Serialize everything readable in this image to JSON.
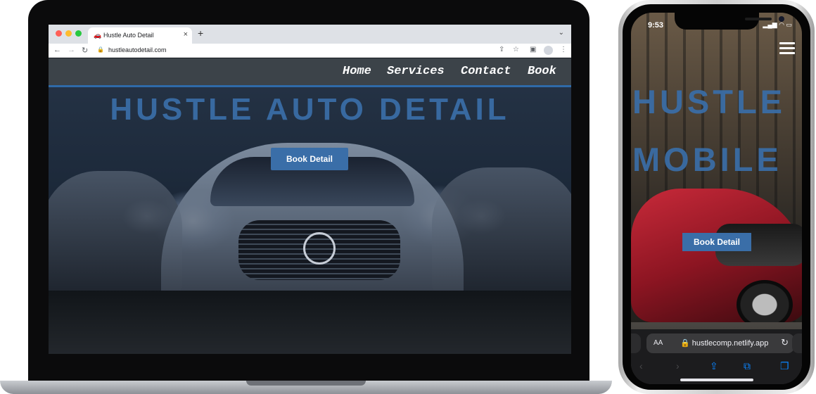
{
  "laptop": {
    "browser": {
      "tab_title": "Hustle Auto Detail",
      "url": "hustleautodetail.com",
      "new_tab_symbol": "+",
      "close_symbol": "×"
    },
    "site": {
      "nav": [
        "Home",
        "Services",
        "Contact",
        "Book"
      ],
      "hero_title": "HUSTLE AUTO DETAIL",
      "cta_label": "Book Detail"
    }
  },
  "phone": {
    "status_time": "9:53",
    "status_icons": "signal, wifi, battery",
    "site": {
      "hero_title_line1": "HUSTLE",
      "hero_title_line2": "MOBILE",
      "cta_label": "Book Detail"
    },
    "safari": {
      "text_size": "AA",
      "url": "hustlecomp.netlify.app"
    }
  },
  "colors": {
    "brand_blue": "#3a6ea8",
    "nav_bar": "#3c4349",
    "tab_bar": "#dee1e6",
    "traffic_red": "#ff5f57",
    "traffic_yellow": "#febc2e",
    "traffic_green": "#28c840",
    "link_blue": "#0a84ff"
  }
}
